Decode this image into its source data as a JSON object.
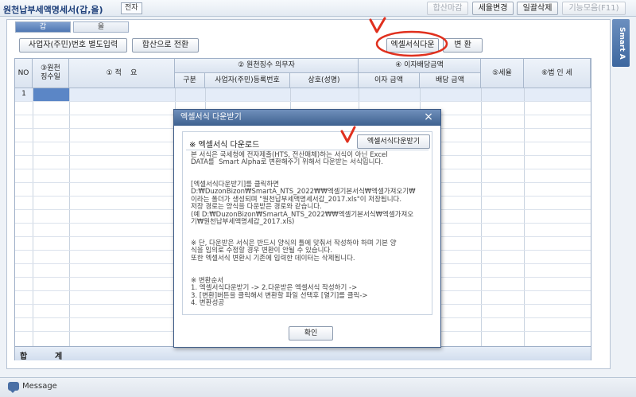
{
  "window": {
    "title": "원천납부세액명세서(갑,을)",
    "tag": "전자"
  },
  "toolbar": {
    "buttons": [
      {
        "label": "합산마감",
        "disabled": true
      },
      {
        "label": "세율변경",
        "disabled": false
      },
      {
        "label": "일괄삭제",
        "disabled": false
      },
      {
        "label": "기능모음(F11)",
        "disabled": true
      }
    ]
  },
  "side_strip": {
    "label": "Smart A"
  },
  "tabs": [
    {
      "label": "갑",
      "active": true
    },
    {
      "label": "을",
      "active": false
    }
  ],
  "actions": {
    "separate_input": "사업자(주민)번호 별도입력",
    "convert_sum": "합산으로 전환",
    "excel_download": "엑셀서식다운",
    "convert": "변 환"
  },
  "grid": {
    "headers": {
      "no": "NO",
      "tax_withholder": "③원천\n징수일",
      "summary": "① 적    요",
      "withholder_group": "② 원천징수 의무자",
      "type": "구분",
      "reg_no": "사업자(주민)등록번호",
      "name": "상호(성명)",
      "amount_group": "④ 이자배당금액",
      "interest": "이자 금액",
      "dividend": "배당 금액",
      "rate": "⑤세율",
      "corp_tax": "⑥법 인 세"
    },
    "rows": [
      {
        "no": "1"
      }
    ],
    "total_label_1": "합",
    "total_label_2": "계"
  },
  "dialog": {
    "title": "엑셀서식 다운받기",
    "close": "×",
    "heading": "※ 엑셀서식 다운로드",
    "download_button": "엑셀서식다운받기",
    "para1": "본 서식은 국세청에 전자제출(HTS, 전산매체)하는 서식이 아닌 Excel\nDATA를  Smart Alpha로 변환해주기 위해서 다운받는 서식입니다.",
    "para2": "[엑셀서식다운받기]를 클릭하면\nD:₩DuzonBizon₩SmartA_NTS_2022₩₩엑셀기본서식₩엑셀가져오기₩\n이라는 폴더가 생성되며 \"원천납부세액명세서갑_2017.xls\"이 저장됩니다.\n저장 경로는 양식을 다운받은 경로와 같습니다.\n(예 D:₩DuzonBizon₩SmartA_NTS_2022₩₩엑셀기본서식₩엑셀가져오\n기₩원천납부세액명세갑_2017.xls)",
    "para3": "※ 단, 다운받은 서식은 반드시 양식의 틀에 맞춰서 작성하야 하며 기본 양\n식을 임의로 수정할 경우 변환이 안될 수 있습니다.\n또한 엑셀서식 변환시 기존에 입력한 데이터는 삭제됩니다.",
    "para4": "※ 변환순서\n1. 엑셀서식다운받기 -> 2.다운받은 엑셀서식 작성하기 ->\n3. [변환]버튼을 클릭해서 변환할 파일 선택후 [열기]를 클릭->\n4. 변환성공",
    "ok_button": "확인"
  },
  "bottom": {
    "message_label": "Message"
  },
  "colors": {
    "annotation": "#e0301e",
    "accent": "#3e618f"
  }
}
